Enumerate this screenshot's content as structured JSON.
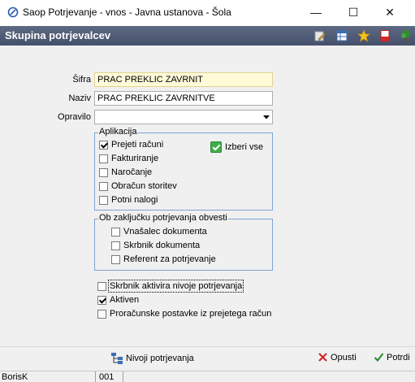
{
  "window": {
    "title": "Saop Potrjevanje - vnos - Javna ustanova - Šola",
    "minimize": "—",
    "maximize": "☐",
    "close": "✕"
  },
  "header": {
    "title": "Skupina potrjevalcev"
  },
  "form": {
    "sifra_label": "Šifra",
    "sifra_value": "PRAC PREKLIC ZAVRNIT",
    "naziv_label": "Naziv",
    "naziv_value": "PRAC PREKLIC ZAVRNITVE",
    "opravilo_label": "Opravilo",
    "opravilo_value": ""
  },
  "aplikacija": {
    "legend": "Aplikacija",
    "items": [
      {
        "label": "Prejeti računi",
        "checked": true
      },
      {
        "label": "Fakturiranje",
        "checked": false
      },
      {
        "label": "Naročanje",
        "checked": false
      },
      {
        "label": "Obračun storitev",
        "checked": false
      },
      {
        "label": "Potni nalogi",
        "checked": false
      }
    ],
    "select_all": "Izberi vse"
  },
  "obvesti": {
    "legend": "Ob zaključku potrjevanja obvesti",
    "items": [
      {
        "label": "Vnašalec dokumenta",
        "checked": false
      },
      {
        "label": "Skrbnik dokumenta",
        "checked": false
      },
      {
        "label": "Referent za potrjevanje",
        "checked": false
      }
    ]
  },
  "options": [
    {
      "label": "Skrbnik aktivira nivoje potrjevanja",
      "checked": false
    },
    {
      "label": "Aktiven",
      "checked": true
    },
    {
      "label": "Proračunske postavke iz prejetega račun",
      "checked": false
    }
  ],
  "buttons": {
    "nivoji": "Nivoji potrjevanja",
    "opusti": "Opusti",
    "potrdi": "Potrdi"
  },
  "status": {
    "user": "BorisK",
    "code": "001"
  },
  "colors": {
    "header_bg": "#4f5b74",
    "field_yellow": "#fffbd9",
    "group_border": "#7fa3d1",
    "cancel_red": "#d22020",
    "confirm_green": "#1f8a2a"
  }
}
